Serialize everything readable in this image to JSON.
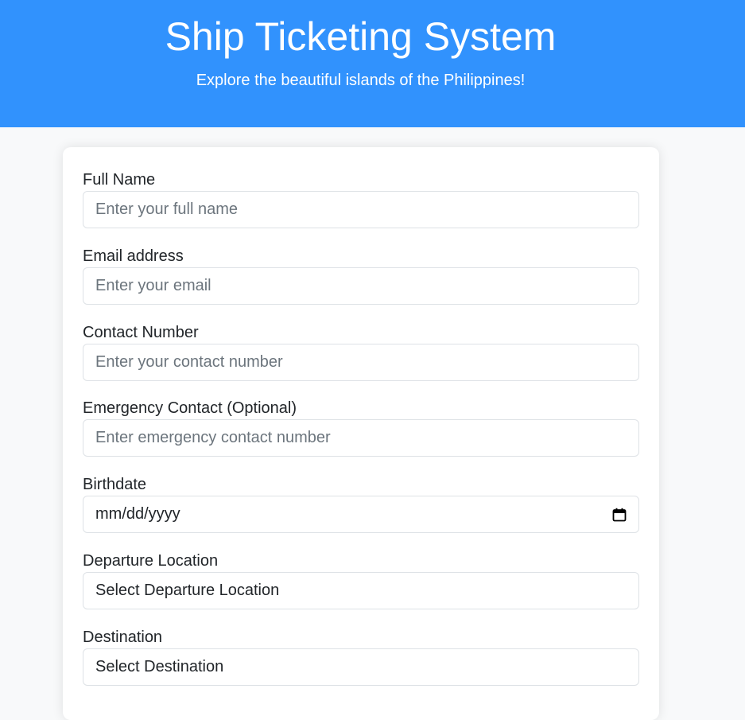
{
  "hero": {
    "title": "Ship Ticketing System",
    "subtitle": "Explore the beautiful islands of the Philippines!",
    "background_color": "#3192fd"
  },
  "form": {
    "full_name": {
      "label": "Full Name",
      "placeholder": "Enter your full name",
      "value": ""
    },
    "email": {
      "label": "Email address",
      "placeholder": "Enter your email",
      "value": ""
    },
    "contact_number": {
      "label": "Contact Number",
      "placeholder": "Enter your contact number",
      "value": ""
    },
    "emergency_contact": {
      "label": "Emergency Contact (Optional)",
      "placeholder": "Enter emergency contact number",
      "value": ""
    },
    "birthdate": {
      "label": "Birthdate",
      "display": "mm/dd/yyyy",
      "icon": "calendar-icon"
    },
    "departure": {
      "label": "Departure Location",
      "selected": "Select Departure Location"
    },
    "destination": {
      "label": "Destination",
      "selected": "Select Destination"
    }
  }
}
